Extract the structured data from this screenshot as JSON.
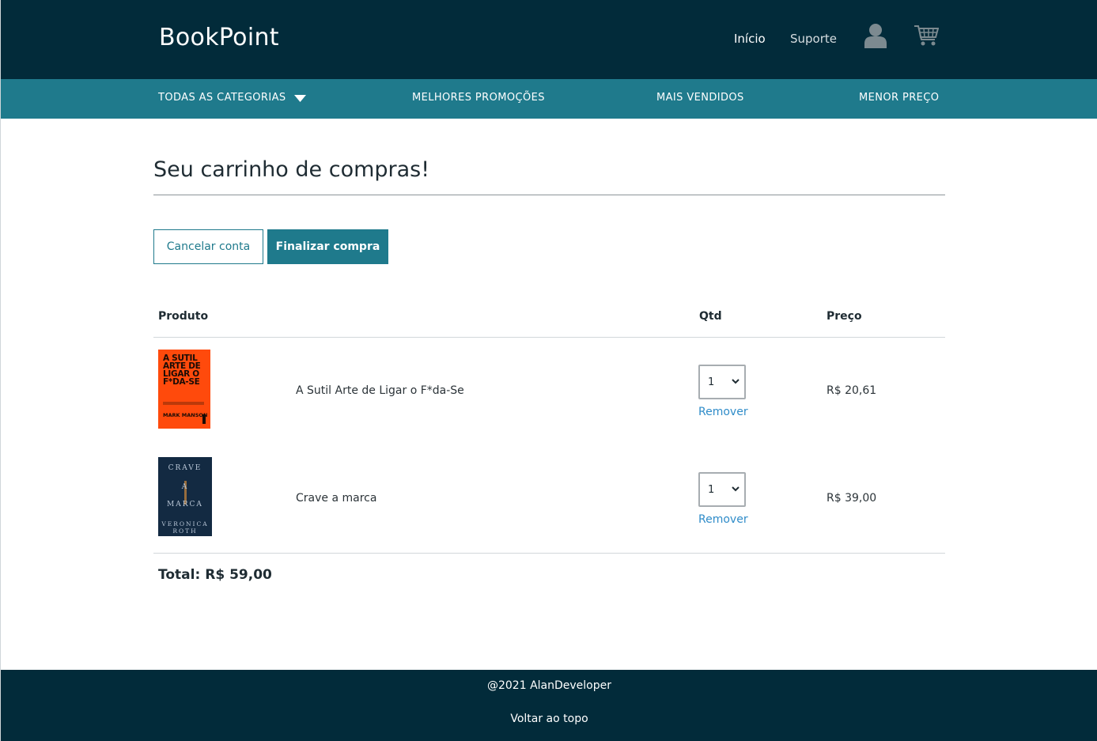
{
  "header": {
    "brand": "BookPoint",
    "nav": {
      "home": "Início",
      "support": "Suporte"
    },
    "icons": {
      "user": "user-icon",
      "cart": "cart-icon"
    }
  },
  "categories": {
    "all": "TODAS AS CATEGORIAS",
    "promo": "MELHORES PROMOÇÕES",
    "best": "MAIS VENDIDOS",
    "cheap": "MENOR PREÇO"
  },
  "cart": {
    "title": "Seu carrinho de compras!",
    "cancel_label": "Cancelar conta",
    "finish_label": "Finalizar compra",
    "columns": {
      "product": "Produto",
      "qty": "Qtd",
      "price": "Preço"
    },
    "items": [
      {
        "name": "A Sutil Arte de Ligar o F*da-Se",
        "cover_title": "A SUTIL ARTE DE LIGAR O F*DA-SE",
        "cover_author": "MARK MANSON",
        "qty": "1",
        "remove_label": "Remover",
        "price": "R$ 20,61"
      },
      {
        "name": "Crave a marca",
        "cover_title_1": "CRAVE",
        "cover_title_2": "A",
        "cover_title_3": "MARCA",
        "cover_author": "VERONICA ROTH",
        "qty": "1",
        "remove_label": "Remover",
        "price": "R$ 39,00"
      }
    ],
    "total_label": "Total:",
    "total_value": "R$ 59,00"
  },
  "footer": {
    "copyright": "@2021 AlanDeveloper",
    "back_to_top": "Voltar ao topo"
  },
  "colors": {
    "dark": "#022b3a",
    "accent": "#1f7a8c",
    "link": "#2f8cc9"
  }
}
